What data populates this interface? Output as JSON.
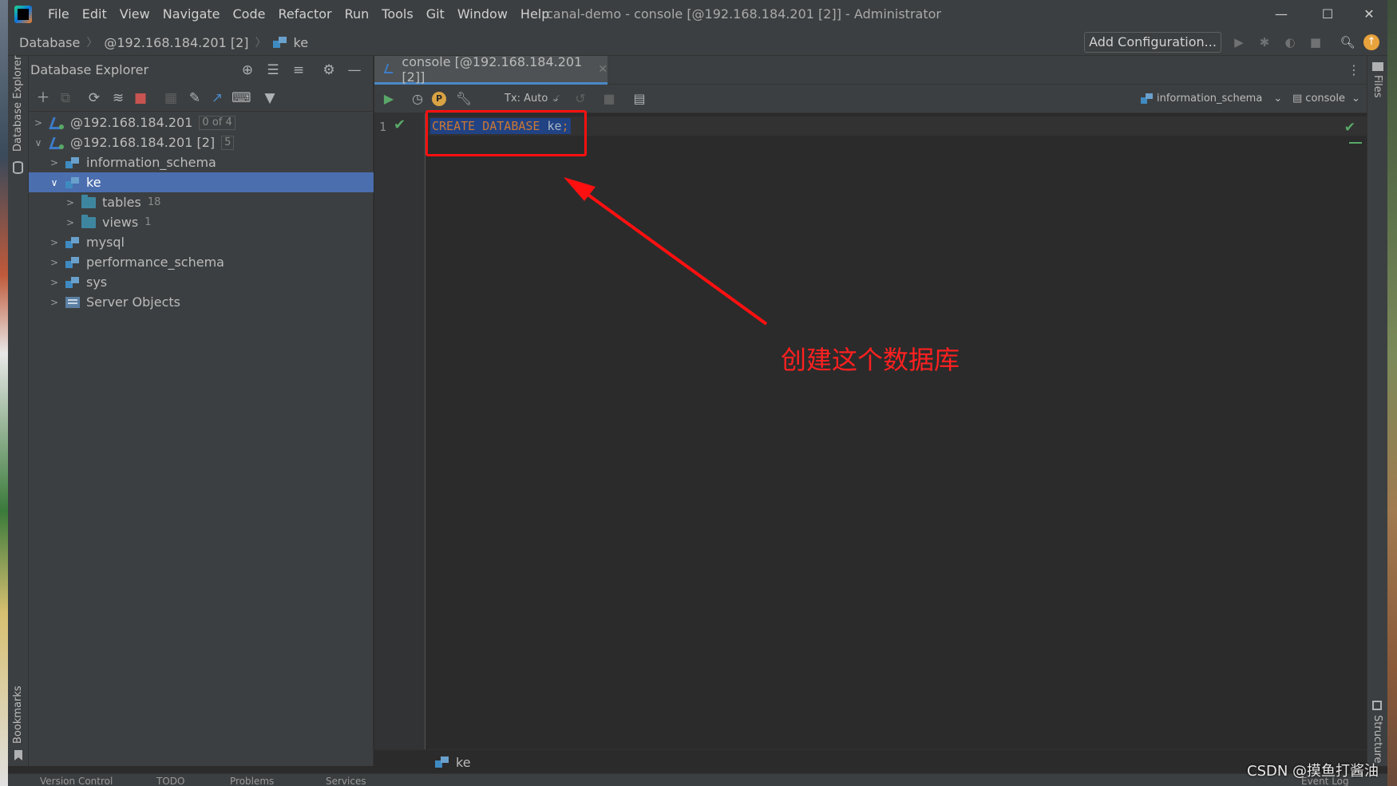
{
  "titlebar": {
    "menu": [
      "File",
      "Edit",
      "View",
      "Navigate",
      "Code",
      "Refactor",
      "Run",
      "Tools",
      "Git",
      "Window",
      "Help"
    ],
    "window_title": "canal-demo - console [@192.168.184.201 [2]] - Administrator",
    "controls": {
      "minimize": "—",
      "maximize": "☐",
      "close": "✕"
    }
  },
  "navbar": {
    "breadcrumb": [
      "Database",
      "@192.168.184.201 [2]",
      "ke"
    ],
    "add_configuration": "Add Configuration..."
  },
  "left_tools": {
    "database_explorer": "Database Explorer",
    "bookmarks": "Bookmarks"
  },
  "right_tools": {
    "files": "Files",
    "structure": "Structure"
  },
  "db_explorer": {
    "title": "Database Explorer",
    "tree": [
      {
        "label": "@192.168.184.201",
        "count": "0 of 4",
        "expanded": false,
        "type": "connection"
      },
      {
        "label": "@192.168.184.201 [2]",
        "count": "5",
        "expanded": true,
        "type": "connection"
      },
      {
        "label": "information_schema",
        "type": "schema"
      },
      {
        "label": "ke",
        "type": "schema",
        "selected": true,
        "expanded": true
      },
      {
        "label": "tables",
        "count": "18",
        "type": "folder"
      },
      {
        "label": "views",
        "count": "1",
        "type": "folder"
      },
      {
        "label": "mysql",
        "type": "schema"
      },
      {
        "label": "performance_schema",
        "type": "schema"
      },
      {
        "label": "sys",
        "type": "schema"
      },
      {
        "label": "Server Objects",
        "type": "server"
      }
    ]
  },
  "editor": {
    "tab_label": "console [@192.168.184.201 [2]]",
    "tx_mode": "Tx: Auto",
    "schema_selector": "information_schema",
    "session_selector": "console",
    "line_number": "1",
    "code": {
      "kw1": "CREATE",
      "kw2": "DATABASE",
      "ident": "ke",
      "semi": ";"
    },
    "footer_crumb": "ke"
  },
  "annotation": {
    "text": "创建这个数据库",
    "color": "#ff1010"
  },
  "bottom_bar": [
    "Version Control",
    "TODO",
    "Problems",
    "Services",
    "Event Log"
  ],
  "watermark": "CSDN @摸鱼打酱油",
  "colors": {
    "selection": "#4b6eaf",
    "keyword": "#cc7832",
    "accent_tab": "#4a88c7",
    "success": "#59a869"
  }
}
